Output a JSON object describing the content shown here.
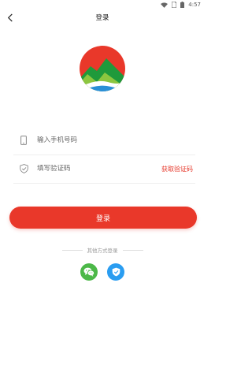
{
  "status_bar": {
    "time": "4:57",
    "icons": [
      "wifi-icon",
      "sim-icon",
      "battery-icon"
    ]
  },
  "nav": {
    "title": "登录",
    "back_icon": "chevron-left-icon"
  },
  "logo": {
    "icon": "mountain-sun-logo",
    "colors": {
      "sun": "#e9382a",
      "mountain_dark": "#1f9a3b",
      "mountain_light": "#8cc63f",
      "water": "#2a8fd6"
    }
  },
  "form": {
    "phone": {
      "icon": "phone-icon",
      "placeholder": "输入手机号码",
      "value": ""
    },
    "code": {
      "icon": "shield-check-icon",
      "placeholder": "填写验证码",
      "value": "",
      "get_code_label": "获取验证码"
    },
    "login_label": "登录"
  },
  "other_login": {
    "label": "其他方式登录",
    "options": [
      {
        "icon": "wechat-icon",
        "color": "#4cb848"
      },
      {
        "icon": "shield-icon",
        "color": "#2a9df1"
      }
    ]
  },
  "colors": {
    "accent": "#e9382a"
  }
}
